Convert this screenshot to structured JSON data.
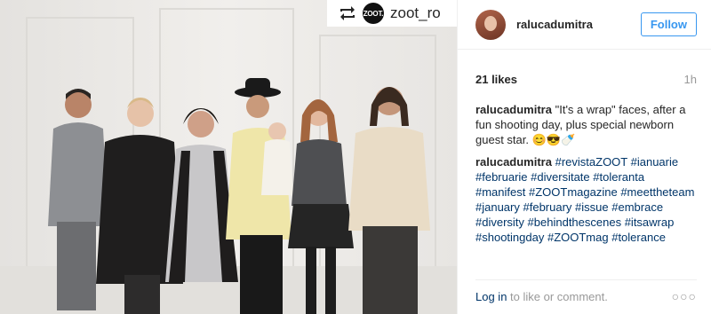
{
  "regram": {
    "avatar_text": "ZOOT.",
    "username": "zoot_ro",
    "icon": "repost-icon"
  },
  "header": {
    "username": "ralucadumitra",
    "follow_label": "Follow"
  },
  "stats": {
    "likes": "21 likes",
    "time_ago": "1h"
  },
  "caption": {
    "username": "ralucadumitra",
    "text": "\"It's a wrap\" faces, after a fun shooting day, plus special newborn guest star. 😊😎🍼"
  },
  "comment": {
    "username": "ralucadumitra",
    "hashtags": [
      "#revistaZOOT",
      "#ianuarie",
      "#februarie",
      "#diversitate",
      "#toleranta",
      "#manifest",
      "#ZOOTmagazine",
      "#meettheteam",
      "#january",
      "#february",
      "#issue",
      "#embrace",
      "#diversity",
      "#behindthescenes",
      "#itsawrap",
      "#shootingday",
      "#ZOOTmag",
      "#tolerance"
    ]
  },
  "footer": {
    "login_link": "Log in",
    "rest": " to like or comment.",
    "more": "○○○"
  }
}
